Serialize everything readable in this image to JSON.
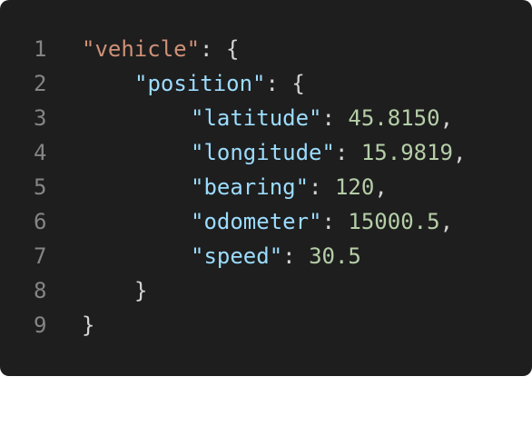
{
  "editor": {
    "lines": [
      {
        "number": "1",
        "key": "\"vehicle\"",
        "sep": ": ",
        "value": "",
        "tail": "{"
      },
      {
        "number": "2",
        "key": "\"position\"",
        "sep": ": ",
        "value": "",
        "tail": "{"
      },
      {
        "number": "3",
        "key": "\"latitude\"",
        "sep": ": ",
        "value": "45.8150",
        "tail": ","
      },
      {
        "number": "4",
        "key": "\"longitude\"",
        "sep": ": ",
        "value": "15.9819",
        "tail": ","
      },
      {
        "number": "5",
        "key": "\"bearing\"",
        "sep": ": ",
        "value": "120",
        "tail": ","
      },
      {
        "number": "6",
        "key": "\"odometer\"",
        "sep": ": ",
        "value": "15000.5",
        "tail": ","
      },
      {
        "number": "7",
        "key": "\"speed\"",
        "sep": ": ",
        "value": "30.5",
        "tail": ""
      },
      {
        "number": "8",
        "key": "",
        "sep": "",
        "value": "",
        "tail": "}"
      },
      {
        "number": "9",
        "key": "",
        "sep": "",
        "value": "",
        "tail": "}"
      }
    ]
  },
  "colors": {
    "background": "#1e1e1e",
    "line_number": "#858585",
    "root_key": "#ce9178",
    "key": "#9cdcfe",
    "number": "#b5cea8",
    "punctuation": "#d4d4d4"
  }
}
